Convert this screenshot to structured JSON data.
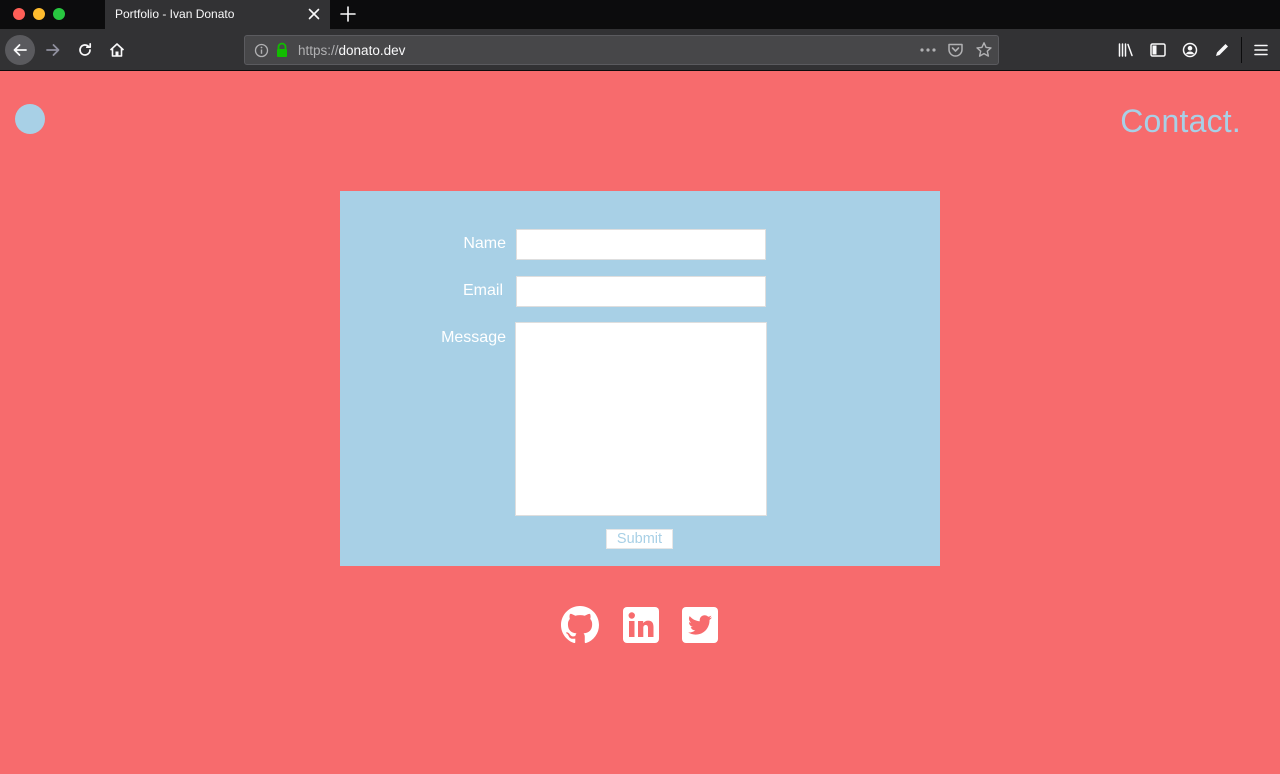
{
  "browser": {
    "tab_title": "Portfolio - Ivan Donato",
    "url_scheme": "https://",
    "url_host": "donato.dev"
  },
  "page": {
    "heading": "Contact.",
    "form": {
      "name_label": "Name",
      "email_label": "Email",
      "message_label": "Message",
      "name_value": "",
      "email_value": "",
      "message_value": "",
      "submit_label": "Submit"
    },
    "social": [
      "github-icon",
      "linkedin-icon",
      "twitter-icon"
    ]
  },
  "colors": {
    "page_background": "#f76b6d",
    "accent": "#a8d0e6",
    "form_text": "#ffffff"
  }
}
